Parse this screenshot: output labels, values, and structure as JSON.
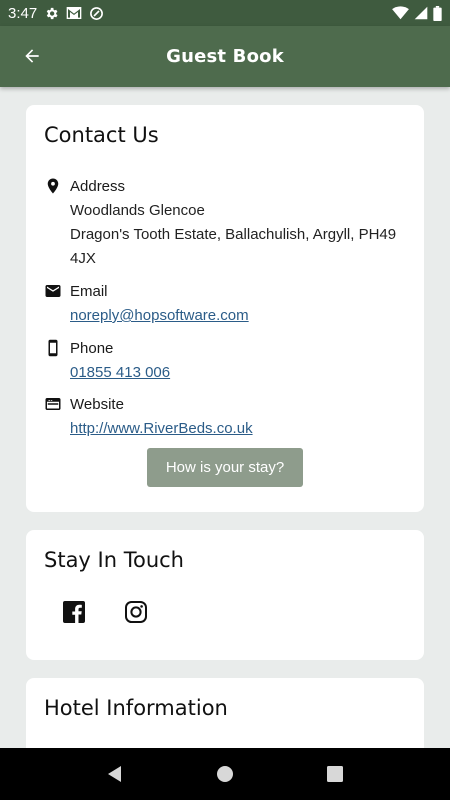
{
  "status_bar": {
    "time": "3:47",
    "icons": [
      "gear-icon",
      "gmail-icon",
      "data-saver-icon",
      "wifi-icon",
      "signal-icon",
      "battery-icon"
    ]
  },
  "app_bar": {
    "title": "Guest Book",
    "back_icon": "arrow-back-icon",
    "background": "#4e6b4d"
  },
  "contact": {
    "title": "Contact Us",
    "address": {
      "icon": "location-pin-icon",
      "label": "Address",
      "line1": "Woodlands Glencoe",
      "line2": "Dragon's Tooth Estate, Ballachulish, Argyll, PH49 4JX"
    },
    "email": {
      "icon": "mail-icon",
      "label": "Email",
      "value": "noreply@hopsoftware.com"
    },
    "phone": {
      "icon": "phone-icon",
      "label": "Phone",
      "value": "01855 413 006"
    },
    "website": {
      "icon": "web-icon",
      "label": "Website",
      "value": "http://www.RiverBeds.co.uk"
    },
    "stay_button": "How is your stay?"
  },
  "stay_in_touch": {
    "title": "Stay In Touch",
    "icons": [
      "facebook-icon",
      "instagram-icon"
    ]
  },
  "hotel_info": {
    "title": "Hotel Information"
  },
  "nav_bar": {
    "icons": [
      "back-triangle-icon",
      "home-circle-icon",
      "recents-square-icon"
    ]
  },
  "colors": {
    "accent": "#4e6b4d",
    "status_bar": "#3f5b3f",
    "link": "#2b5c88",
    "button": "#8e9c8c",
    "background": "#e9eceb"
  }
}
